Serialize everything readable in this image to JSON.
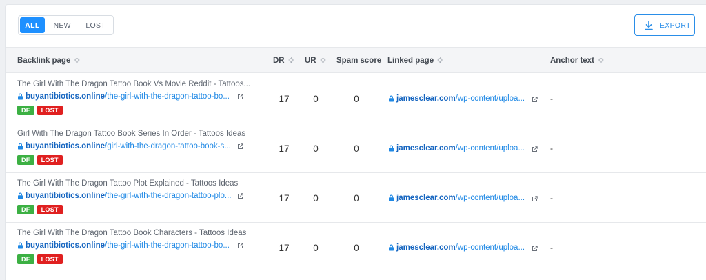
{
  "filters": {
    "tabs": [
      {
        "label": "ALL",
        "active": true
      },
      {
        "label": "NEW",
        "active": false
      },
      {
        "label": "LOST",
        "active": false
      }
    ]
  },
  "toolbar": {
    "export_label": "EXPORT",
    "export_icon": "download-icon"
  },
  "table": {
    "headers": {
      "backlink_page": "Backlink page",
      "dr": "DR",
      "ur": "UR",
      "spam_score": "Spam score",
      "linked_page": "Linked page",
      "anchor_text": "Anchor text"
    },
    "rows": [
      {
        "title": "The Girl With The Dragon Tattoo Book Vs Movie Reddit - Tattoos...",
        "url_domain": "buyantibiotics.online",
        "url_path": "/the-girl-with-the-dragon-tattoo-bo...",
        "badges": [
          "DF",
          "LOST"
        ],
        "dr": "17",
        "ur": "0",
        "spam": "0",
        "linked_domain": "jamesclear.com",
        "linked_path": "/wp-content/uploa...",
        "anchor": "-"
      },
      {
        "title": "Girl With The Dragon Tattoo Book Series In Order - Tattoos Ideas",
        "url_domain": "buyantibiotics.online",
        "url_path": "/girl-with-the-dragon-tattoo-book-s...",
        "badges": [
          "DF",
          "LOST"
        ],
        "dr": "17",
        "ur": "0",
        "spam": "0",
        "linked_domain": "jamesclear.com",
        "linked_path": "/wp-content/uploa...",
        "anchor": "-"
      },
      {
        "title": "The Girl With The Dragon Tattoo Plot Explained - Tattoos Ideas",
        "url_domain": "buyantibiotics.online",
        "url_path": "/the-girl-with-the-dragon-tattoo-plo...",
        "badges": [
          "DF",
          "LOST"
        ],
        "dr": "17",
        "ur": "0",
        "spam": "0",
        "linked_domain": "jamesclear.com",
        "linked_path": "/wp-content/uploa...",
        "anchor": "-"
      },
      {
        "title": "The Girl With The Dragon Tattoo Book Characters - Tattoos Ideas",
        "url_domain": "buyantibiotics.online",
        "url_path": "/the-girl-with-the-dragon-tattoo-bo...",
        "badges": [
          "DF",
          "LOST"
        ],
        "dr": "17",
        "ur": "0",
        "spam": "0",
        "linked_domain": "jamesclear.com",
        "linked_path": "/wp-content/uploa...",
        "anchor": "-"
      }
    ]
  },
  "colors": {
    "accent": "#1e90ff",
    "link": "#1e88e5",
    "badge_df": "#3cb043",
    "badge_lost": "#e02020"
  }
}
